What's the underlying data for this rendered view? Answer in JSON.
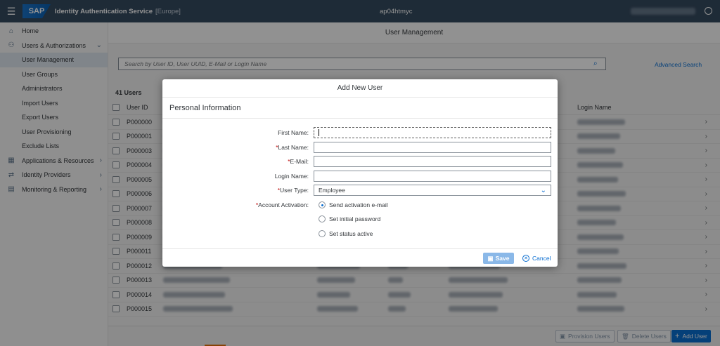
{
  "header": {
    "logo": "SAP",
    "app_name": "Identity Authentication Service",
    "region": "[Europe]",
    "tenant": "ap04htmyc"
  },
  "sidebar": {
    "items": [
      {
        "label": "Home",
        "icon": "home-icon",
        "level": 0
      },
      {
        "label": "Users & Authorizations",
        "icon": "users-icon",
        "level": 0,
        "expanded": true
      },
      {
        "label": "User Management",
        "level": 1,
        "active": true
      },
      {
        "label": "User Groups",
        "level": 1
      },
      {
        "label": "Administrators",
        "level": 1
      },
      {
        "label": "Import Users",
        "level": 1
      },
      {
        "label": "Export Users",
        "level": 1
      },
      {
        "label": "User Provisioning",
        "level": 1
      },
      {
        "label": "Exclude Lists",
        "level": 1
      },
      {
        "label": "Applications & Resources",
        "icon": "applications-icon",
        "level": 0
      },
      {
        "label": "Identity Providers",
        "icon": "identity-providers-icon",
        "level": 0
      },
      {
        "label": "Monitoring & Reporting",
        "icon": "monitoring-icon",
        "level": 0
      }
    ]
  },
  "main": {
    "title": "User Management",
    "search_placeholder": "Search by User ID, User UUID, E-Mail or Login Name",
    "advanced_search": "Advanced Search",
    "count_label": "41 Users",
    "columns": {
      "user_id": "User ID",
      "login_name": "Login Name"
    },
    "user_ids": [
      "P000000",
      "P000001",
      "P000003",
      "P000004",
      "P000005",
      "P000006",
      "P000007",
      "P000008",
      "P000009",
      "P000011",
      "P000012",
      "P000013",
      "P000014",
      "P000015"
    ],
    "bottom": {
      "provision_users": "Provision Users",
      "delete_users": "Delete Users",
      "add_user": "Add User"
    }
  },
  "dialog": {
    "title": "Add New User",
    "section": "Personal Information",
    "fields": {
      "first_name": "First Name:",
      "last_name": "Last Name:",
      "email": "E-Mail:",
      "login_name": "Login Name:",
      "user_type": "User Type:",
      "user_type_value": "Employee",
      "account_activation": "Account Activation:"
    },
    "required_mark": "*",
    "activation_options": [
      "Send activation e-mail",
      "Set initial password",
      "Set status active"
    ],
    "selected_activation": "Send activation e-mail",
    "save": "Save",
    "cancel": "Cancel"
  },
  "colors": {
    "shell": "#354a5f",
    "accent": "#0a6ed1",
    "required": "#bb0000"
  }
}
